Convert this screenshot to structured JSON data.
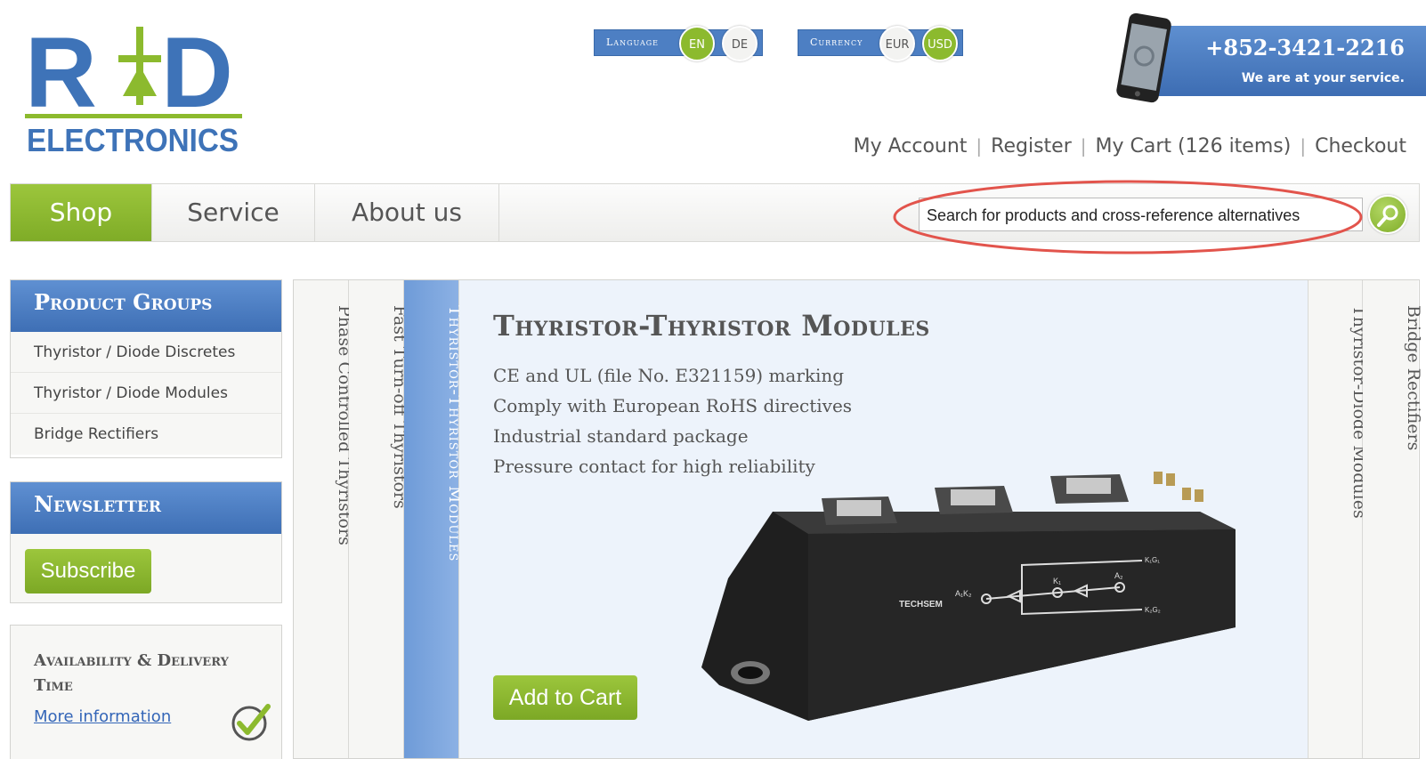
{
  "brand": {
    "logo_top": "R†D",
    "logo_bottom": "ELECTRONICS",
    "colors": {
      "blue": "#3e73b8",
      "green": "#8cba2e"
    }
  },
  "language": {
    "label": "Language",
    "options": [
      "EN",
      "DE"
    ],
    "selected": "EN"
  },
  "currency": {
    "label": "Currency",
    "options": [
      "EUR",
      "USD"
    ],
    "selected": "USD"
  },
  "contact": {
    "phone": "+852-3421-2216",
    "tagline": "We are at your service.",
    "icon": "mobile-phone-icon"
  },
  "account_links": {
    "my_account": "My Account",
    "register": "Register",
    "my_cart": "My Cart (126 items)",
    "checkout": "Checkout"
  },
  "nav": {
    "shop": "Shop",
    "service": "Service",
    "about": "About us",
    "active": "Shop"
  },
  "search": {
    "value": "Search for products and cross-reference alternatives",
    "icon": "search-icon"
  },
  "sidebar": {
    "product_groups": {
      "title": "Product Groups",
      "items": [
        "Thyristor / Diode Discretes",
        "Thyristor / Diode Modules",
        "Bridge Rectifiers"
      ]
    },
    "newsletter": {
      "title": "Newsletter",
      "button": "Subscribe"
    },
    "availability": {
      "title": "Availability & Delivery Time",
      "link": "More information",
      "icon": "checkmark-icon"
    }
  },
  "product": {
    "tabs": [
      "Phase Controlled Thyristors",
      "Fast Turn-off Thyristors",
      "Thyristor-Thyristor Modules",
      "Thyristor-Diode Modules",
      "Bridge Rectifiers"
    ],
    "active_tab": "Thyristor-Thyristor Modules",
    "title": "Thyristor-Thyristor Modules",
    "features": [
      "CE and UL (file No. E321159) marking",
      "Comply with European RoHS directives",
      "Industrial standard package",
      "Pressure contact for high reliability"
    ],
    "add_to_cart": "Add to Cart",
    "image": {
      "brand_label": "TECHSEM",
      "circuit_labels": [
        "A₁K₂",
        "K₁",
        "A₂",
        "K₁G₁",
        "K₂G₂"
      ]
    }
  }
}
